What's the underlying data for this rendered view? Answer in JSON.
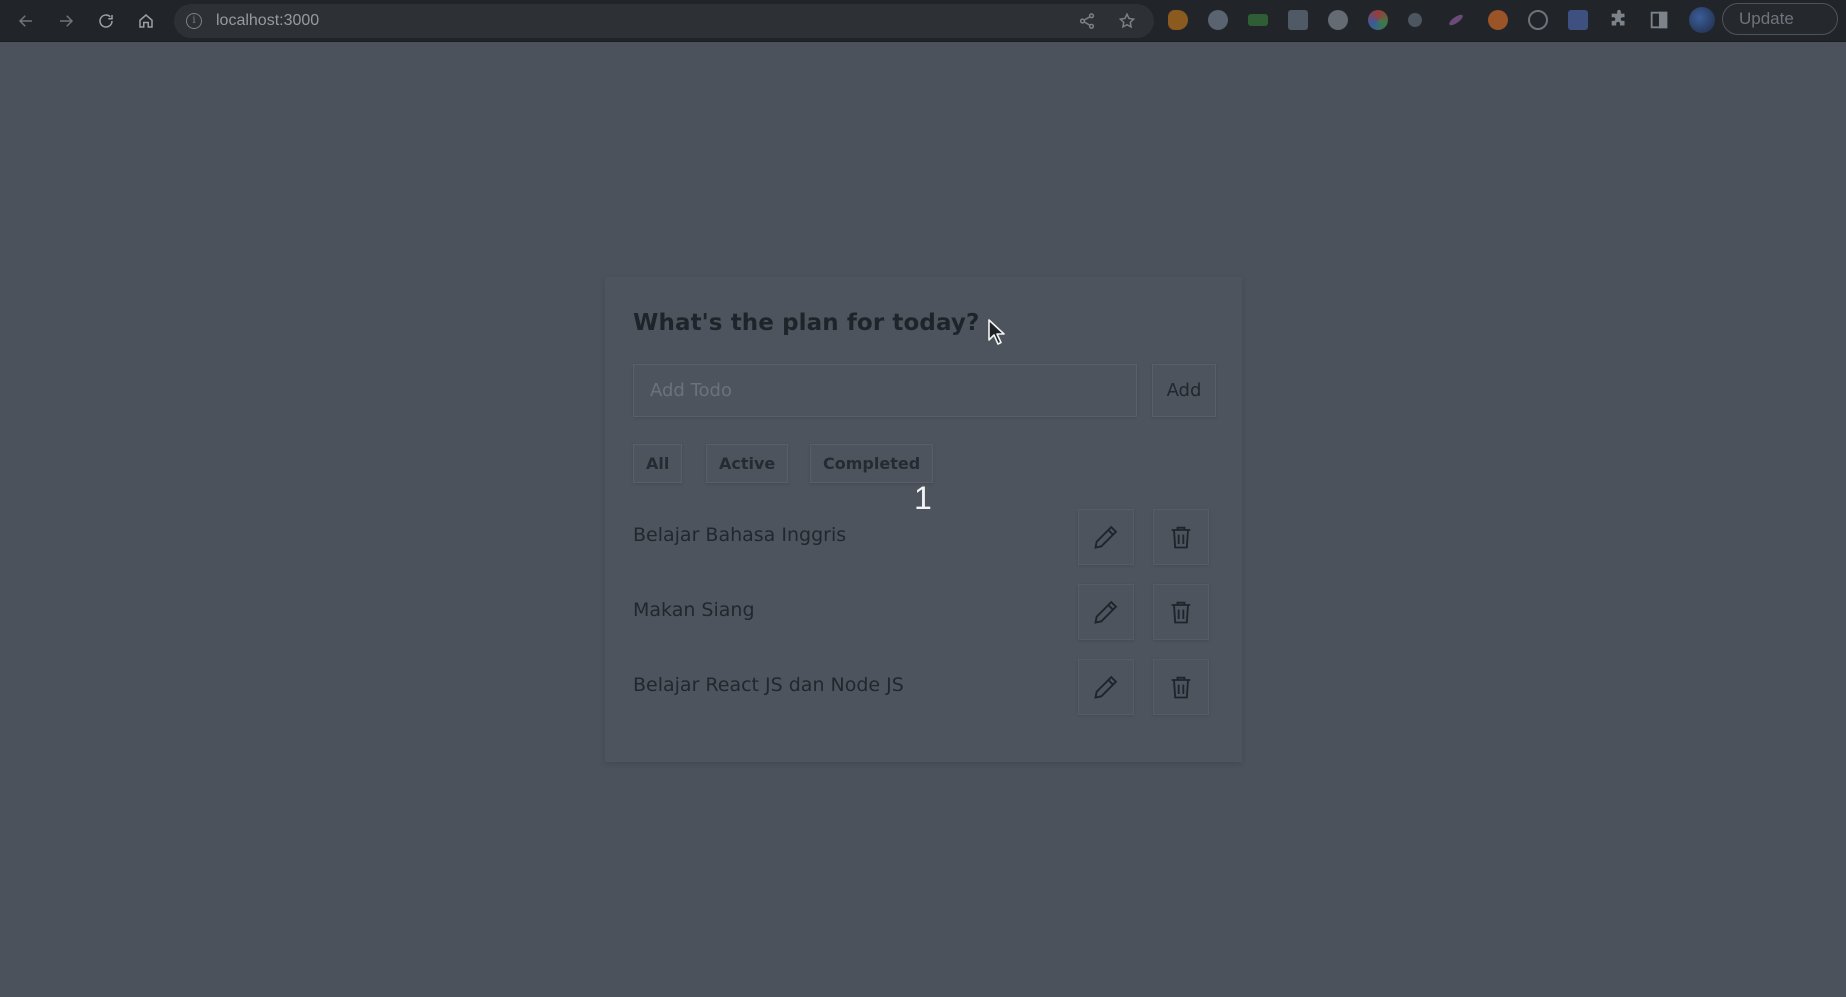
{
  "browser": {
    "url": "localhost:3000",
    "update_label": "Update",
    "nav": [
      "back-icon",
      "forward-icon",
      "reload-icon",
      "home-icon"
    ],
    "extensions_colors": [
      "#a86a1f",
      "#5a6470",
      "#2f6a3a",
      "#4f5a66",
      "#646b73",
      "#9a3b3b",
      "#4d5560",
      "#8a5a9a",
      "#a3582a",
      "#5c6570",
      "#3d5a8a"
    ]
  },
  "app": {
    "heading": "What's the plan for today?",
    "input": {
      "placeholder": "Add Todo",
      "value": ""
    },
    "add_label": "Add",
    "filters": [
      {
        "label": "All"
      },
      {
        "label": "Active"
      },
      {
        "label": "Completed"
      }
    ],
    "counter": "1",
    "todos": [
      {
        "text": "Belajar Bahasa Inggris"
      },
      {
        "text": "Makan Siang"
      },
      {
        "text": "Belajar React JS dan Node JS"
      }
    ],
    "icons": {
      "edit": "pencil-icon",
      "delete": "trash-icon"
    }
  },
  "colors": {
    "page_bg": "#4b525b",
    "card_bg": "#4e545d",
    "text": "#22272d",
    "counter": "#f2f3f5"
  }
}
